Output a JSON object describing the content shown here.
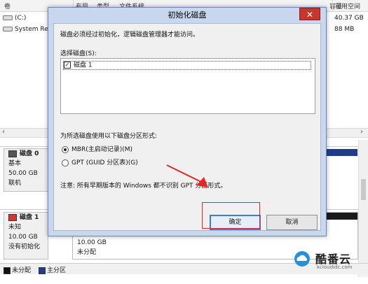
{
  "background": {
    "columns": [
      "卷",
      "布局",
      "类型",
      "文件系统",
      "状态",
      "容量",
      "可用空间"
    ],
    "volumes": [
      {
        "name": "(C:)",
        "capacity": "",
        "free": "40.37 GB"
      },
      {
        "name": "System Re",
        "capacity": "",
        "free": "88 MB"
      }
    ],
    "disk0": {
      "title": "磁盘 0",
      "type": "基本",
      "size": "50.00 GB",
      "status": "联机"
    },
    "disk1": {
      "title": "磁盘 1",
      "type": "未知",
      "size": "10.00 GB",
      "status": "没有初始化",
      "partition_size": "10.00 GB",
      "partition_state": "未分配"
    },
    "legend": {
      "unallocated": "未分配",
      "primary": "主分区"
    }
  },
  "dialog": {
    "title": "初始化磁盘",
    "close_label": "✕",
    "intro": "磁盘必须经过初始化，逻辑磁盘管理器才能访问。",
    "select_label": "选择磁盘(S):",
    "disks": [
      {
        "label": "磁盘 1",
        "checked": true
      }
    ],
    "style_label": "为所选磁盘使用以下磁盘分区形式:",
    "mbr_label": "MBR(主启动记录)(M)",
    "gpt_label": "GPT (GUID 分区表)(G)",
    "note": "注意: 所有早期版本的 Windows 都不识别 GPT 分区形式。",
    "ok_label": "确定",
    "cancel_label": "取消"
  },
  "watermark": {
    "name": "酷番云",
    "url": "kcloudidc.com"
  },
  "colors": {
    "highlight": "#e02a2a",
    "title_bar": "#c9d7ee",
    "primary_partition": "#1f3d8c"
  }
}
